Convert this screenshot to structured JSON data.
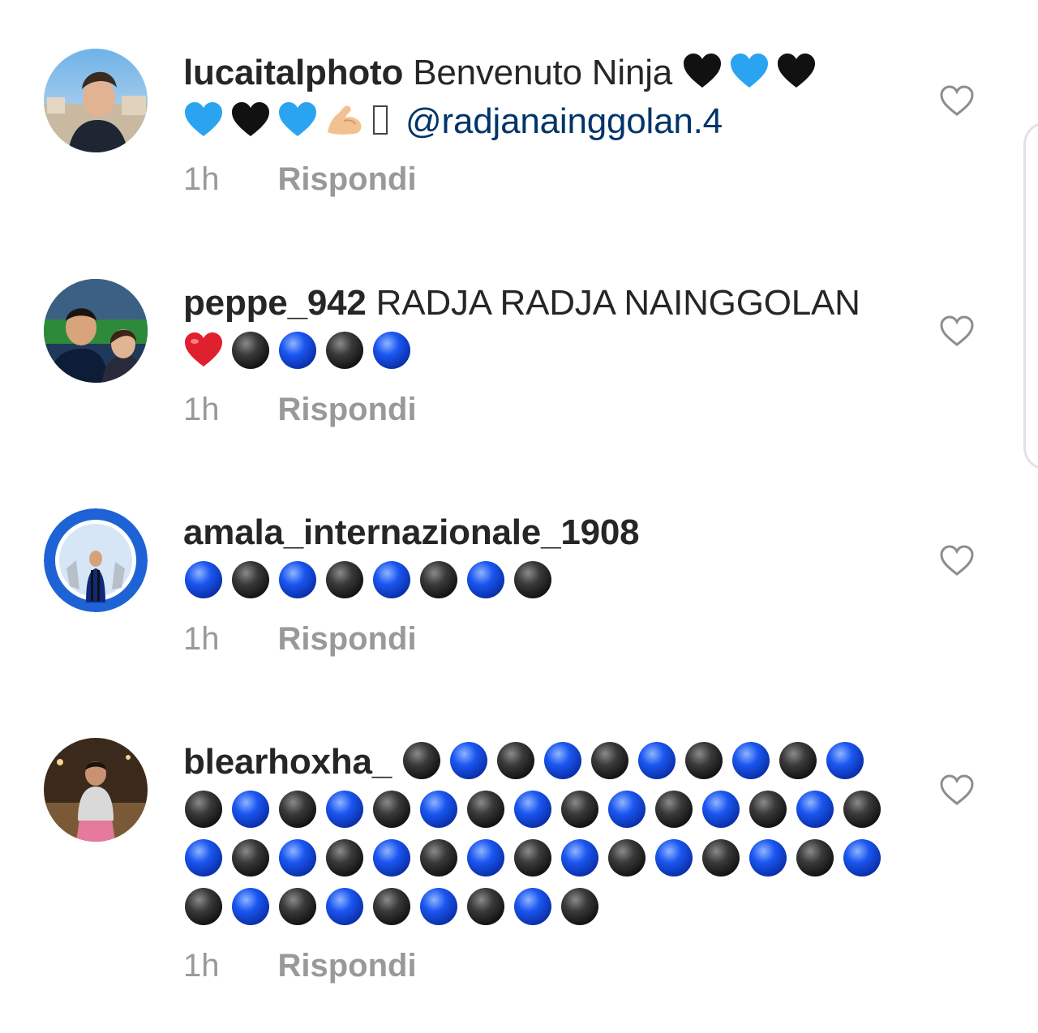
{
  "comments": [
    {
      "username": "lucaitalphoto",
      "text": "Benvenuto Ninja",
      "emojis_1": [
        "black-heart",
        "blue-heart",
        "black-heart",
        "blue-heart",
        "black-heart",
        "blue-heart",
        "flexed-biceps",
        "missing-glyph"
      ],
      "mention": "@radjanainggolan.4",
      "time": "1h",
      "reply_label": "Rispondi",
      "avatar": "man-with-city-background"
    },
    {
      "username": "peppe_942",
      "text": "RADJA RADJA NAINGGOLAN",
      "emojis_1": [
        "red-heart",
        "black-circle",
        "blue-circle",
        "black-circle",
        "blue-circle"
      ],
      "time": "1h",
      "reply_label": "Rispondi",
      "avatar": "couple-at-stadium"
    },
    {
      "username": "amala_internazionale_1908",
      "text": "",
      "emojis_1": [
        "blue-circle",
        "black-circle",
        "blue-circle",
        "black-circle",
        "blue-circle",
        "black-circle",
        "blue-circle",
        "black-circle"
      ],
      "time": "1h",
      "reply_label": "Rispondi",
      "avatar": "inter-badge-with-trophies"
    },
    {
      "username": "blearhoxha_",
      "text": "",
      "emojis_1": [
        "black-circle",
        "blue-circle",
        "black-circle",
        "blue-circle",
        "black-circle",
        "blue-circle",
        "black-circle",
        "blue-circle",
        "black-circle",
        "blue-circle",
        "black-circle",
        "blue-circle",
        "black-circle",
        "blue-circle",
        "black-circle",
        "blue-circle",
        "black-circle",
        "blue-circle",
        "black-circle",
        "blue-circle",
        "black-circle",
        "blue-circle",
        "black-circle",
        "blue-circle",
        "black-circle",
        "blue-circle",
        "black-circle",
        "blue-circle",
        "black-circle",
        "blue-circle",
        "black-circle",
        "blue-circle",
        "black-circle",
        "blue-circle",
        "black-circle",
        "blue-circle",
        "black-circle",
        "blue-circle",
        "black-circle",
        "blue-circle",
        "black-circle",
        "blue-circle",
        "black-circle",
        "blue-circle",
        "black-circle",
        "blue-circle",
        "black-circle",
        "blue-circle",
        "black-circle"
      ],
      "time": "1h",
      "reply_label": "Rispondi",
      "avatar": "man-at-beach-night"
    }
  ],
  "icons": {
    "like": "heart-outline-icon"
  },
  "colors": {
    "text": "#262626",
    "secondary": "#999999",
    "mention": "#003569",
    "blue_circle": "#1a56f0",
    "black_circle": "#2b2b2b"
  }
}
